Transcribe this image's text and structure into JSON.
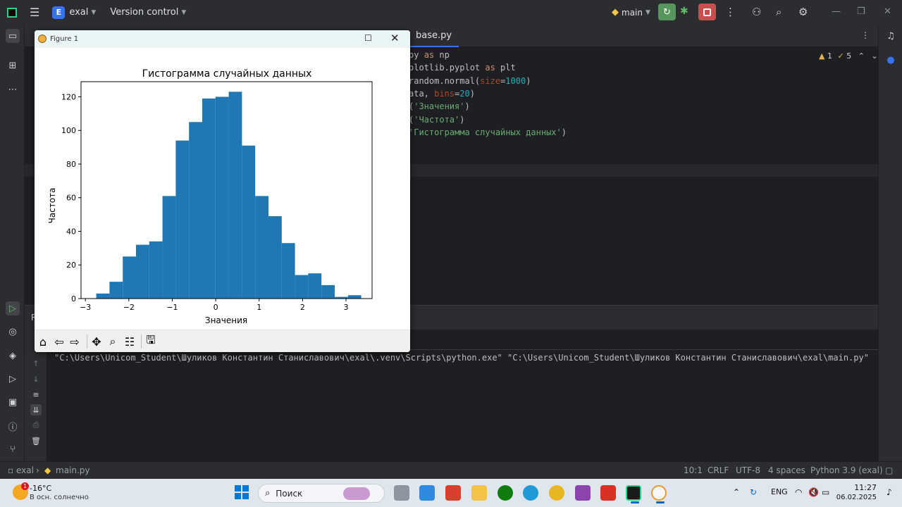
{
  "ide": {
    "project_badge": "E",
    "project_name": "exal",
    "vcs_menu": "Version control",
    "branch": "main",
    "file_tab": "base.py",
    "inspections": {
      "warnings": "1",
      "weak_warnings": "5"
    },
    "code_lines": [
      [
        "",
        "py ",
        "as",
        " np"
      ],
      [
        "",
        "plotlib.pyplot ",
        "as",
        " plt"
      ]
    ],
    "code": {
      "line3": [
        "random.normal(",
        "size",
        "=",
        "1000",
        ")"
      ],
      "line4": [
        "ata, ",
        "bins",
        "=",
        "20",
        ")"
      ],
      "line5": [
        "(",
        "'Значения'",
        ")"
      ],
      "line6": [
        "(",
        "'Частота'",
        ")"
      ],
      "line7": [
        "",
        "'Гистограмма случайных данных'",
        ")"
      ]
    },
    "run_tab_initial": "R",
    "console_command": "\"C:\\Users\\Unicom_Student\\Шуликов Константин Станиславович\\exal\\.venv\\Scripts\\python.exe\" \"C:\\Users\\Unicom_Student\\Шуликов Константин Станиславович\\exal\\main.py\"",
    "status": {
      "breadcrumb_project": "exal",
      "breadcrumb_file": "main.py",
      "position": "10:1",
      "line_sep": "CRLF",
      "encoding": "UTF-8",
      "indent": "4 spaces",
      "interpreter": "Python 3.9 (exal)"
    }
  },
  "figure": {
    "window_title": "Figure 1",
    "chart_data": {
      "type": "bar",
      "title": "Гистограмма случайных данных",
      "xlabel": "Значения",
      "ylabel": "Частота",
      "bar_color": "#1f77b4",
      "x_ticks": [
        -3,
        -2,
        -1,
        0,
        1,
        2,
        3
      ],
      "y_ticks": [
        0,
        20,
        40,
        60,
        80,
        100,
        120
      ],
      "xlim": [
        -3.1,
        3.6
      ],
      "ylim": [
        0,
        129
      ],
      "bin_start": -2.75,
      "bin_width": 0.305,
      "values": [
        3,
        10,
        25,
        32,
        34,
        61,
        94,
        105,
        119,
        120,
        123,
        91,
        61,
        49,
        33,
        14,
        15,
        8,
        1,
        2
      ]
    },
    "toolbar_icons": [
      "home-icon",
      "back-icon",
      "forward-icon",
      "pan-icon",
      "zoom-icon",
      "subplots-icon",
      "save-icon"
    ]
  },
  "taskbar": {
    "weather_badge": "1",
    "temperature": "-16°C",
    "condition": "В осн. солнечно",
    "search_label": "Поиск",
    "language": "ENG",
    "time": "11:27",
    "date": "06.02.2025"
  }
}
